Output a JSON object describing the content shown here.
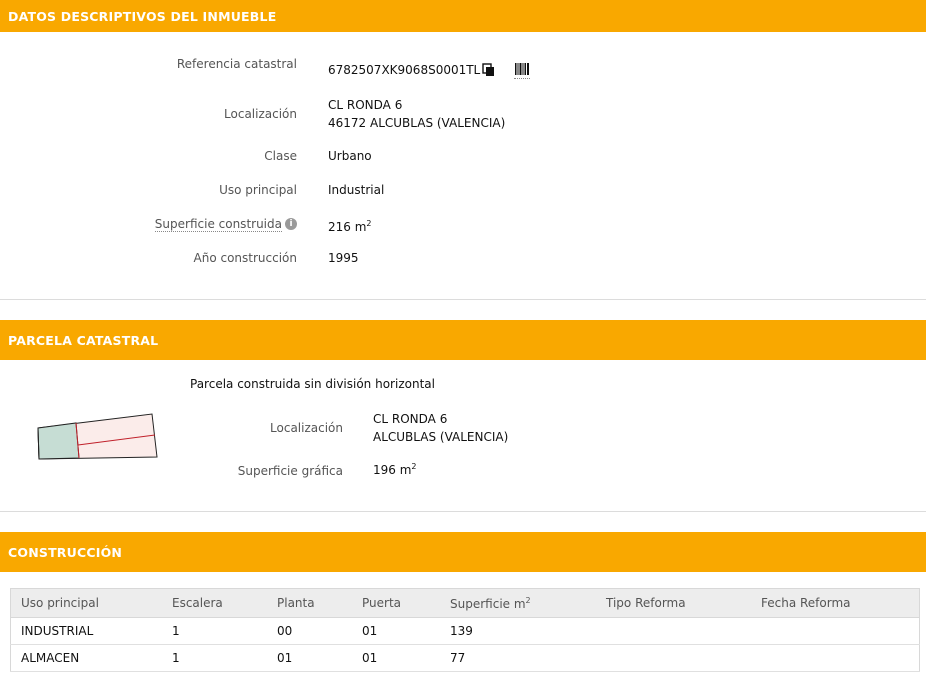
{
  "inmueble": {
    "header": "DATOS DESCRIPTIVOS DEL INMUEBLE",
    "fields": {
      "referencia": {
        "label": "Referencia catastral",
        "value": "6782507XK9068S0001TL"
      },
      "localizacion": {
        "label": "Localización",
        "line1": "CL RONDA 6",
        "line2": "46172 ALCUBLAS (VALENCIA)"
      },
      "clase": {
        "label": "Clase",
        "value": "Urbano"
      },
      "uso": {
        "label": "Uso principal",
        "value": "Industrial"
      },
      "superficie": {
        "label": "Superficie construida",
        "value": "216 m",
        "unit_sup": "2"
      },
      "anio": {
        "label": "Año construcción",
        "value": "1995"
      }
    }
  },
  "parcela": {
    "header": "PARCELA CATASTRAL",
    "subtitle": "Parcela construida sin división horizontal",
    "localizacion": {
      "label": "Localización",
      "line1": "CL RONDA 6",
      "line2": "ALCUBLAS (VALENCIA)"
    },
    "superficie": {
      "label": "Superficie gráfica",
      "value": "196 m",
      "unit_sup": "2"
    }
  },
  "construccion": {
    "header": "CONSTRUCCIÓN",
    "columns": {
      "uso": "Uso principal",
      "escalera": "Escalera",
      "planta": "Planta",
      "puerta": "Puerta",
      "superficie": "Superficie m",
      "superficie_sup": "2",
      "tipo": "Tipo Reforma",
      "fecha": "Fecha Reforma"
    },
    "rows": [
      {
        "uso": "INDUSTRIAL",
        "escalera": "1",
        "planta": "00",
        "puerta": "01",
        "superficie": "139",
        "tipo": "",
        "fecha": ""
      },
      {
        "uso": "ALMACEN",
        "escalera": "1",
        "planta": "01",
        "puerta": "01",
        "superficie": "77",
        "tipo": "",
        "fecha": ""
      }
    ]
  },
  "icons": {
    "copy": "copy-icon",
    "barcode": "barcode-icon",
    "info": "info-icon",
    "parcel_map": "parcel-map-icon"
  },
  "colors": {
    "header_bg": "#f9a800",
    "header_text": "#ffffff",
    "parcel_fill": "#fbecea",
    "parcel_highlight": "#c6ddd4",
    "parcel_line": "#c0202a"
  }
}
